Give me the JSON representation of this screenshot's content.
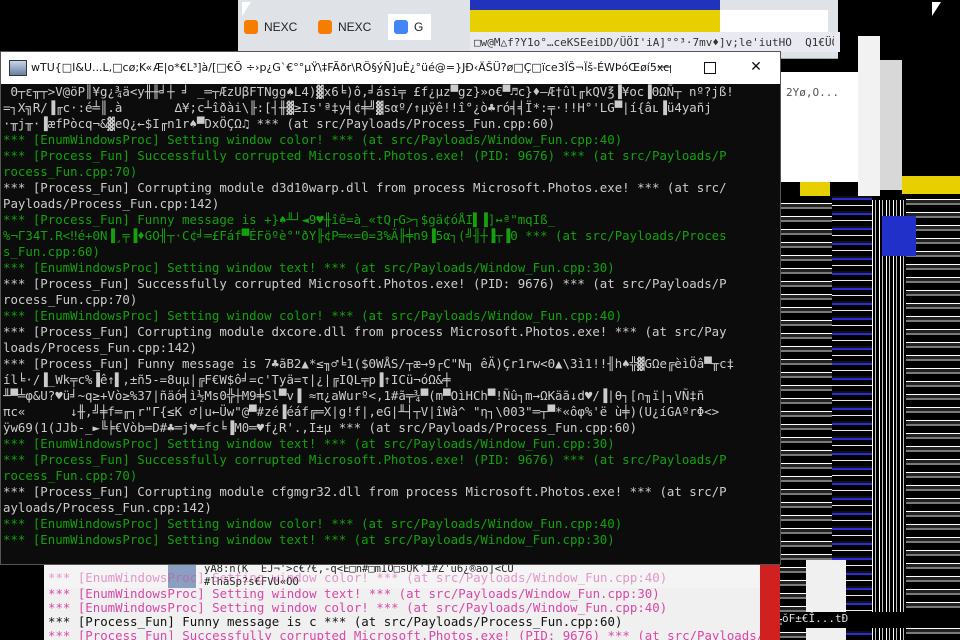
{
  "background": {
    "browser_tabs": [
      {
        "label": "NEXC",
        "icon": "blogger-icon",
        "color": "#f57d00"
      },
      {
        "label": "NEXC",
        "icon": "blogger-icon",
        "color": "#f57d00"
      },
      {
        "label": "G",
        "icon": "google-icon",
        "color": "#4285f4"
      }
    ],
    "garbled_title_strip": "□w@M△f?Y1o°…ceKSEeiDD/ÜÖI'iA]°°³·7mv♦]v;le'iutHO  Q1€ÜÖB",
    "side_window_title": "2Yø,O...",
    "lower_icon_text": "ÿÄ8:n(K  ÉJ¬'>c€?€,-q<E□n#□mIÖ□sUK'1#Z'ü6¿®ao]<CÜ",
    "lower_icon_text2": "#lhäSp?s€FVÜ«ÖÖ",
    "bottom_echo": [
      "*** [EnumWindowsProc] Setting window color! *** (at src/Payloads/Window_Fun.cpp:40)",
      "*** [EnumWindowsProc] Setting window text! *** (at src/Payloads/Window_Fun.cpp:30)",
      "*** [EnumWindowsProc] Setting window color! *** (at src/Payloads/Window_Fun.cpp:40)",
      "*** [Process_Fun] Funny message is c *** (at src/Payloads/Process_Fun.cpp:60)",
      "*** [Process_Fun] Successfully corrupted Microsoft.Photos.exe! (PID: 9676) *** (at src/Payloads/P"
    ],
    "right_noise_text": "ŏF±€Î...tĐ"
  },
  "terminal": {
    "title": "wTU{□I&U...L,□cø;K«Æ|o*€L³]à/[□€Ö ÷›p¿G`€°°µŸ\\‡FÃðr\\RÖ§ýÑ]uÈ¿°üé@=}JÐ‹ÄŠÜ?ø□Ç□ïce3ÏŠ¬Ïš-ÉWÞóŒøí5xcµq–é8...",
    "minimize_label": "—",
    "close_label": "✕",
    "lines": [
      {
        "c": "w",
        "t": " Θ┬ε╥┬>V@öP║¥g¿¾ä<y╫╫╛┼ ╛ _═┬ÆzUβFTNgg♠L4)▓x6╘)ô,╛ási╤ £f¿μz▀gz}»o€▀♬c}♦–Æ†ûl╓kQV℥▐¥oc▐ΘΩÑ┬ nº?jß!"
      },
      {
        "c": "w",
        "t": "=┐X╗R/▐╓c·:é╧║.à       ∆¥;c┴îðài\\╟:[┤╫▓≥Is'ª‡y╡¢╪╝▓sαº/↑µÿê!!î°¿ò♣ró╡╡Ï*:╤·!!H°'LG▀|í{âʟ▐ü4yañj"
      },
      {
        "c": "w",
        "t": "·╥j╥·▐æfPòcq¬&▓eQ¿←$I╓n1r♠▀DxÖÇΩ♫ *** (at src/Payloads/Process_Fun.cpp:60)"
      },
      {
        "c": "g",
        "t": "*** [EnumWindowsProc] Setting window color! *** (at src/Payloads/Window_Fun.cpp:40)"
      },
      {
        "c": "g",
        "t": "*** [Process_Fun] Successfully corrupted Microsoft.Photos.exe! (PID: 9676) *** (at src/Payloads/P"
      },
      {
        "c": "g",
        "t": "rocess_Fun.cpp:70)"
      },
      {
        "c": "w",
        "t": "*** [Process_Fun] Corrupting module d3d10warp.dll from process Microsoft.Photos.exe! *** (at src/"
      },
      {
        "c": "w",
        "t": "Payloads/Process_Fun.cpp:142)"
      },
      {
        "c": "g",
        "t": "*** [Process_Fun] Funny message is +}♠╨┘◄9♥╫îê=à_«tQ┌G>┐$gä¢óÅI▌▐]↔ª\"mqIß_"
      },
      {
        "c": "g",
        "t": "%¬Γ34T.R<‼é+ΘN▐¸╤▐♦GO╢┬·C¢╛═£Fáf▀ÉFöºè°\"ðY╟¢P═«=Θ=3%Ä╟╪n9▐5α┐(╝╢┼▐┬▐Θ *** (at src/Payloads/Proces"
      },
      {
        "c": "g",
        "t": "s_Fun.cpp:60)"
      },
      {
        "c": "g",
        "t": "*** [EnumWindowsProc] Setting window text! *** (at src/Payloads/Window_Fun.cpp:30)"
      },
      {
        "c": "w",
        "t": "*** [Process_Fun] Successfully corrupted Microsoft.Photos.exe! (PID: 9676) *** (at src/Payloads/P"
      },
      {
        "c": "w",
        "t": "rocess_Fun.cpp:70)"
      },
      {
        "c": "g",
        "t": "*** [EnumWindowsProc] Setting window color! *** (at src/Payloads/Window_Fun.cpp:40)"
      },
      {
        "c": "w",
        "t": "*** [Process_Fun] Corrupting module dxcore.dll from process Microsoft.Photos.exe! *** (at src/Pay"
      },
      {
        "c": "w",
        "t": "loads/Process_Fun.cpp:142)"
      },
      {
        "c": "w",
        "t": "*** [Process_Fun] Funny message is 7♣ãB2▲*≤╖♂╘1($ΘWÅS/┬æ→9┌C\"N╖ êÄ)Çr1rw<Θ▲\\3ì1!!╢h♠╬▓GΩe╔èìÖâ▀╥c‡"
      },
      {
        "c": "w",
        "t": "íl╘·/▐_Wk╤c%▐ê↑▌,±ñ5-=8uµ|╔F€W$ô╛=c'Tyä=τ|¿|╔IQL╤p▐↑ICü¬óΩ&╪"
      },
      {
        "c": "w",
        "t": "╨▀╧φ&U?♥ü╛~q≥+Vò≥%37|ñäó╡ì½Ms0╬┼M9╪Sl▀v▐ ≈π¿aWurº<,1#ã╤¾▀(m▀OìHCh▀!Ñû┐m→ΩKäã↓d♥/▐|θ┐[∩╖ï|┐VÑ‡ñ"
      },
      {
        "c": "w",
        "t": "πc«      ↓╫,╝╪f═╓┐r\"Γ{≤K ♂|u←Üw\"@▀#zé▐éáf╔═X|g!f|,eG|╨┤┬V|îWà^ \"η┐\\Θ03\"═┬▀*«ôφ%'ë ù╪)(U¿íGAºrΦ<>"
      },
      {
        "c": "w",
        "t": "ÿw69(1(JJb-_►╚╞€Vòb═D#♣═j♥═fc╘▐M0═♥f¿R'.,I±µ *** (at src/Payloads/Process_Fun.cpp:60)"
      },
      {
        "c": "g",
        "t": "*** [EnumWindowsProc] Setting window text! *** (at src/Payloads/Window_Fun.cpp:30)"
      },
      {
        "c": "g",
        "t": "*** [Process_Fun] Successfully corrupted Microsoft.Photos.exe! (PID: 9676) *** (at src/Payloads/P"
      },
      {
        "c": "g",
        "t": "rocess_Fun.cpp:70)"
      },
      {
        "c": "w",
        "t": "*** [Process_Fun] Corrupting module cfgmgr32.dll from process Microsoft.Photos.exe! *** (at src/P"
      },
      {
        "c": "w",
        "t": "ayloads/Process_Fun.cpp:142)"
      },
      {
        "c": "g",
        "t": "*** [EnumWindowsProc] Setting window color! *** (at src/Payloads/Window_Fun.cpp:40)"
      },
      {
        "c": "g",
        "t": "*** [EnumWindowsProc] Setting window text! *** (at src/Payloads/Window_Fun.cpp:30)"
      }
    ]
  },
  "colors": {
    "console_bg": "#0c0c0c",
    "console_white": "#cccccc",
    "console_green": "#13a10e",
    "echo_pink": "#d848a8"
  }
}
